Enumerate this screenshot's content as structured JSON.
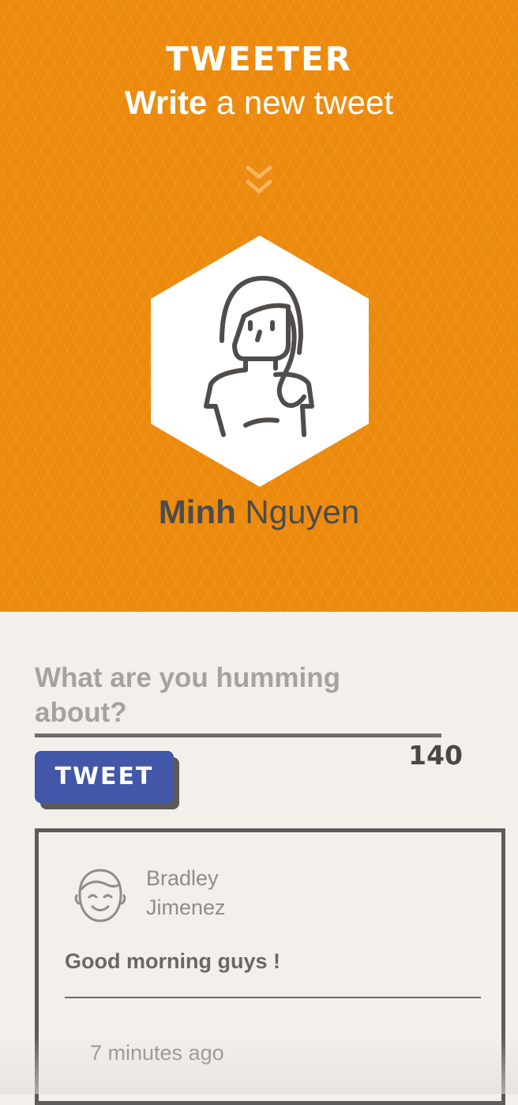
{
  "header": {
    "app_title": "TWEETER",
    "subtitle_strong": "Write",
    "subtitle_rest": " a new tweet",
    "user": {
      "first_name": "Minh",
      "last_name": " Nguyen"
    }
  },
  "composer": {
    "placeholder": "What are you humming about?",
    "char_counter": "140",
    "tweet_button_label": "TWEET"
  },
  "tweets": [
    {
      "author_first": "Bradley",
      "author_last": "Jimenez",
      "text": "Good morning guys !",
      "time": "7 minutes ago"
    }
  ],
  "colors": {
    "header_bg": "#ec8a0d",
    "page_bg": "#f3f0ec",
    "button_bg": "#4257a8",
    "chevron": "#f7b45c"
  },
  "icons": {
    "chevron": "double-chevron-down-icon",
    "profile_avatar": "woman-avatar-icon",
    "tweet_avatar": "smiling-man-avatar-icon"
  }
}
